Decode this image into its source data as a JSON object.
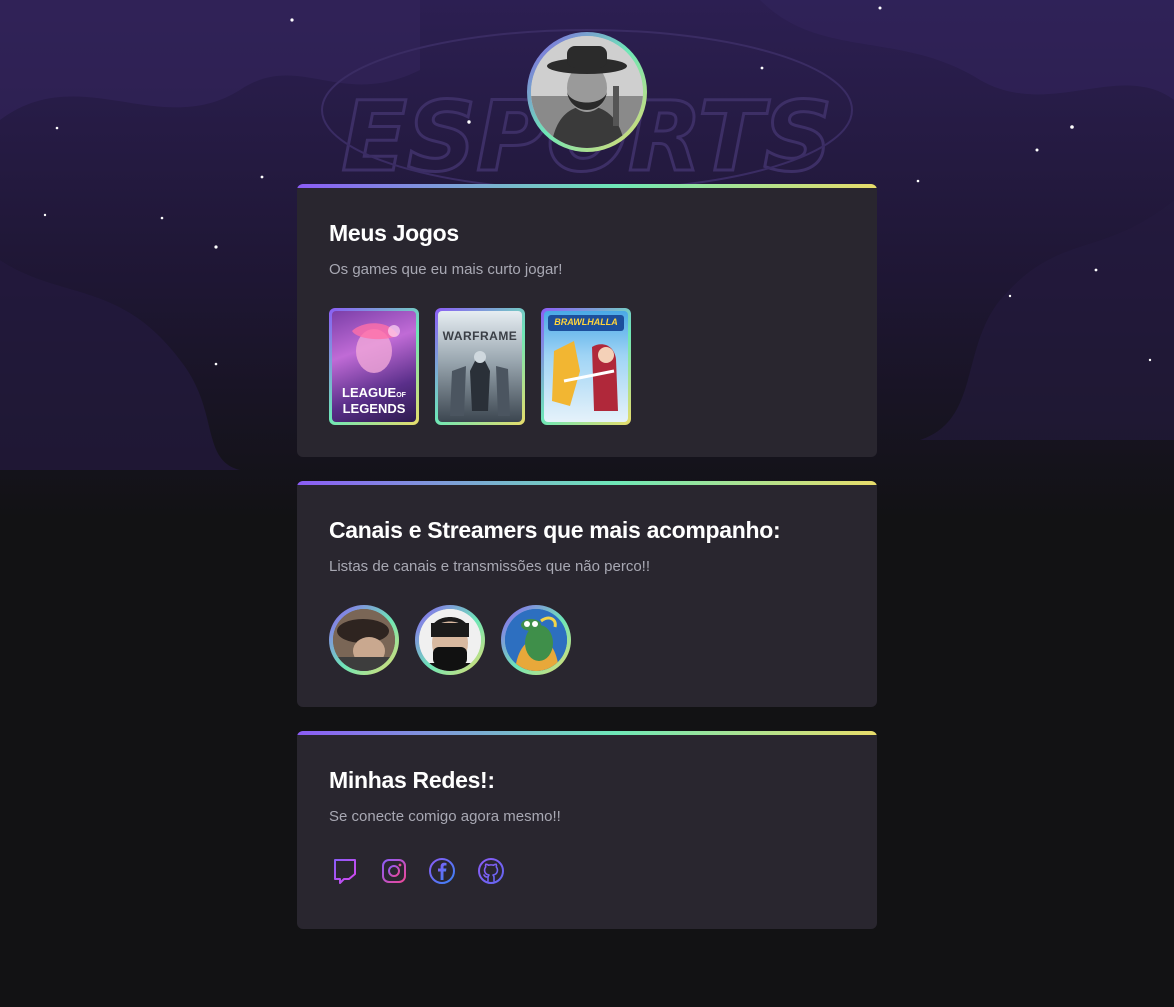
{
  "profile": {
    "avatar_icon": "profile-photo"
  },
  "background": {
    "logo_text": "ESPORTS"
  },
  "games_card": {
    "title": "Meus Jogos",
    "subtitle": "Os games que eu mais curto jogar!",
    "games": [
      {
        "line1": "LEAGUE",
        "of": "OF",
        "line2": "LEGENDS"
      },
      {
        "name": "WARFRAME"
      },
      {
        "name": "BRAWLHALLA"
      }
    ]
  },
  "streamers_card": {
    "title": "Canais e Streamers que mais acompanho:",
    "subtitle": "Listas de canais e transmissões que não perco!!"
  },
  "socials_card": {
    "title": "Minhas Redes!:",
    "subtitle": "Se conecte comigo agora mesmo!!",
    "icons": [
      "twitch-icon",
      "instagram-icon",
      "facebook-icon",
      "github-icon"
    ]
  },
  "colors": {
    "background": "#121214",
    "card": "#29262f",
    "accent_purple": "#8b5cf6",
    "accent_green": "#6ee7b7",
    "accent_yellow": "#e8dc6a"
  }
}
